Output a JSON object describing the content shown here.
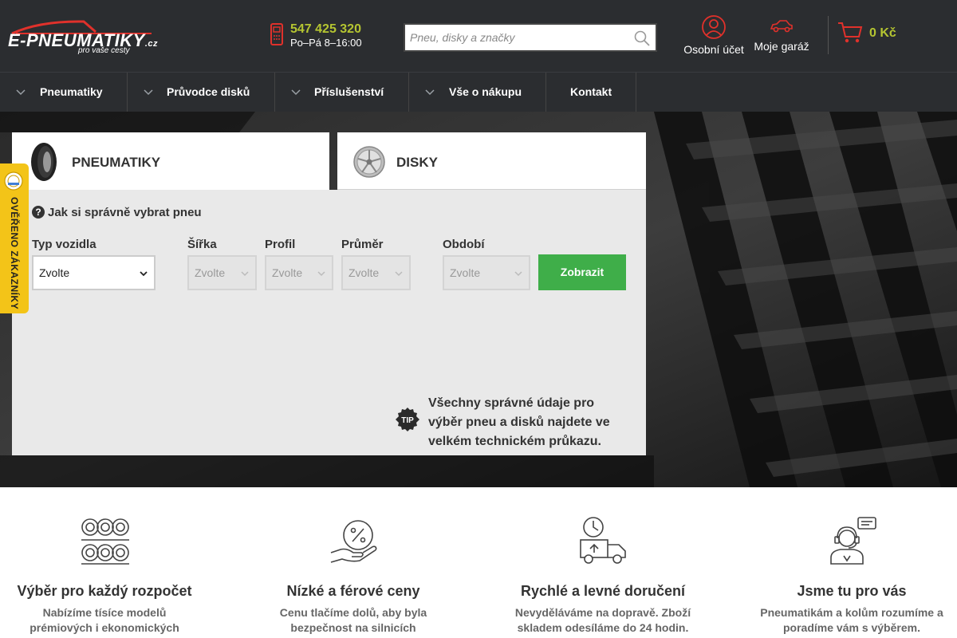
{
  "header": {
    "logo_text": "E-PNEUMATIKY",
    "logo_tld": ".cz",
    "logo_slogan": "pro vaše cesty",
    "phone": "547 425 320",
    "hours": "Po–Pá 8–16:00",
    "search_placeholder": "Pneu, disky a značky",
    "account_label": "Osobní účet",
    "garage_label": "Moje garáž",
    "cart_total": "0 Kč"
  },
  "nav": {
    "items": [
      {
        "label": "Pneumatiky",
        "dropdown": true
      },
      {
        "label": "Průvodce disků",
        "dropdown": true
      },
      {
        "label": "Příslušenství",
        "dropdown": true
      },
      {
        "label": "Vše o nákupu",
        "dropdown": true
      },
      {
        "label": "Kontakt",
        "dropdown": false
      }
    ]
  },
  "search_panel": {
    "tabs": [
      {
        "label": "PNEUMATIKY",
        "active": true
      },
      {
        "label": "DISKY",
        "active": false
      }
    ],
    "help_link": "Jak si správně vybrat pneu",
    "fields": [
      {
        "label": "Typ vozidla",
        "value": "Zvolte",
        "disabled": false
      },
      {
        "label": "Šířka",
        "value": "Zvolte",
        "disabled": true
      },
      {
        "label": "Profil",
        "value": "Zvolte",
        "disabled": true
      },
      {
        "label": "Průměr",
        "value": "Zvolte",
        "disabled": true
      },
      {
        "label": "Období",
        "value": "Zvolte",
        "disabled": true
      }
    ],
    "submit_label": "Zobrazit",
    "tip_badge": "TIP",
    "tip_text": "Všechny správné údaje pro výběr pneu a disků najdete ve velkém technickém průkazu."
  },
  "verified_badge": "OVĚŘENO ZÁKAZNÍKY",
  "features": [
    {
      "icon": "tire-stack-icon",
      "title": "Výběr pro každý rozpočet",
      "desc": "Nabízíme tísíce modelů prémiových i ekonomických"
    },
    {
      "icon": "percent-hand-icon",
      "title": "Nízké a férové ceny",
      "desc": "Cenu tlačíme dolů, aby byla bezpečnost na silnicích"
    },
    {
      "icon": "delivery-truck-icon",
      "title": "Rychlé a levné doručení",
      "desc": "Nevyděláváme na dopravě. Zboží skladem odesíláme do 24 hodin."
    },
    {
      "icon": "support-agent-icon",
      "title": "Jsme tu pro vás",
      "desc": "Pneumatikám a kolům rozumíme a poradíme vám s výběrem."
    }
  ],
  "colors": {
    "header_bg": "#2b2d30",
    "accent_green": "#3fae49",
    "accent_lime": "#b5c531",
    "logo_red": "#e0312b",
    "badge_yellow": "#f3c418"
  }
}
